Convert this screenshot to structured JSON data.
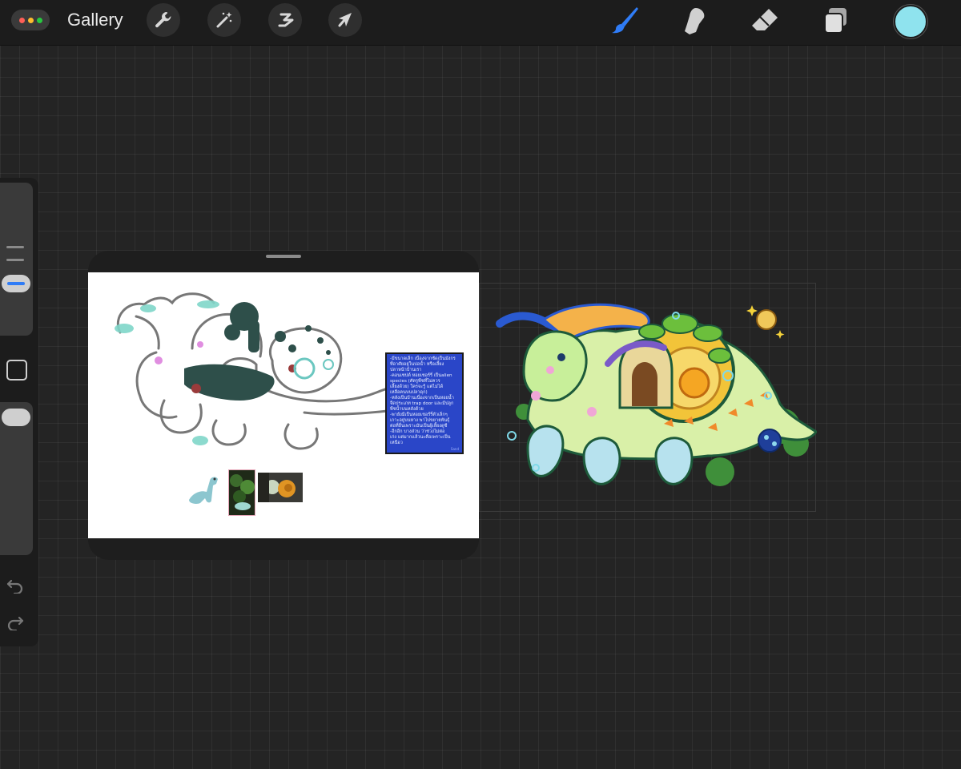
{
  "toolbar": {
    "menu_button_icon": "more-dots-icon",
    "gallery_label": "Gallery",
    "left_tools": [
      "wrench-icon",
      "magic-wand-icon",
      "selection-icon",
      "transform-arrow-icon"
    ],
    "right_tools": [
      "brush-icon",
      "smudge-icon",
      "eraser-icon",
      "layers-icon"
    ],
    "active_tool": "brush-icon",
    "accent_color": "#2f7cf6",
    "current_color": "#8fe3ee",
    "menu_dot_colors": [
      "#ff5f57",
      "#febc2e",
      "#28c840"
    ]
  },
  "sidebar": {
    "brush_size_level": 0.58,
    "opacity_level": 0.93,
    "modify_button_icon": "square-modify-icon",
    "undo_icon": "undo-icon",
    "redo_icon": "redo-icon"
  },
  "reference_window": {
    "note_lines": [
      "-มีขนาดเล็ก เนื่องจากซัดเป็นมังกร",
      "ที่อาศัยอยู่ในบ่อน้ำ หรือเลี้ยง",
      "ปลาหน้าบ้านเรา",
      "-คอนเซปต์ หอยเชอร์รี่ เป็นalien",
      "species (ศัตรูพืชที่ไม่ควร",
      "เลี้ยงด้วย) ใครจะรู้ แต่ไม่ได้",
      "เหลือคนบนปลาดุก)",
      "-หลังเป็นบ้านเนื่องจากเป็นหอยน้ำ",
      "จืดประเภท trap door และมีปลูก",
      "พืชน้ำบนหลังด้วย",
      "-พายังมีเป็นหอยเชอร์รี่ตัวเล็กๆ",
      "เกาะอยู่บนหาง พาไปขยายพันธุ์",
      "ต่อที่อื่นเพราะมันเป็นผู้เลี้ยงดูซี",
      "-อีกอีก บางส่วน ว่าช่วงไม่ต่อ",
      "เก่ง แต่มากแล้วนะคือเพราะเป็น",
      "เหนือว"
    ],
    "note_signature": "Sand"
  }
}
